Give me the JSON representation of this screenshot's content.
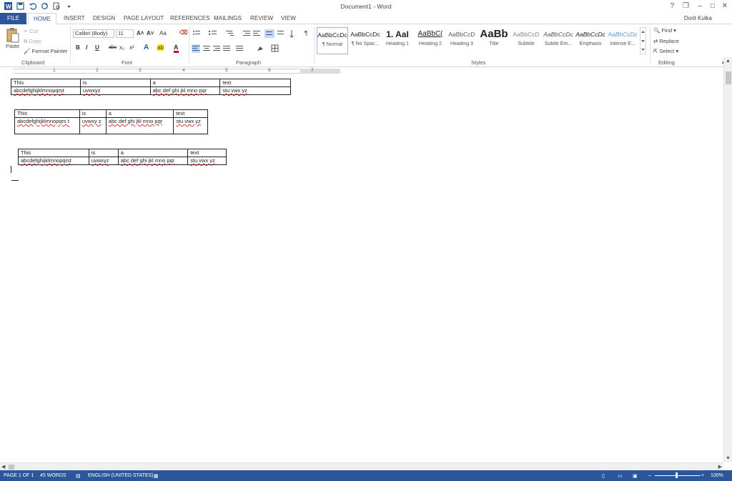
{
  "window": {
    "title": "Document1 - Word",
    "user_name": "Dorit Kulka",
    "help": "?",
    "controls": [
      "❐",
      "–",
      "□",
      "✕"
    ]
  },
  "quick_access": {
    "items": [
      "word-icon",
      "save-icon",
      "undo-icon",
      "redo-icon",
      "print-preview-icon",
      "customize-icon"
    ]
  },
  "tabs": {
    "file": "FILE",
    "home": "HOME",
    "insert": "INSERT",
    "design": "DESIGN",
    "page_layout": "PAGE LAYOUT",
    "references": "REFERENCES",
    "mailings": "MAILINGS",
    "review": "REVIEW",
    "view": "VIEW"
  },
  "clipboard": {
    "paste": "Paste",
    "cut": "Cut",
    "copy": "Copy",
    "format_painter": "Format Painter",
    "label": "Clipboard"
  },
  "font": {
    "name": "Calibri (Body)",
    "size": "11",
    "bold": "B",
    "italic": "I",
    "underline": "U",
    "strikethrough": "abc",
    "subscript": "x₂",
    "superscript": "x²",
    "grow": "A˄",
    "shrink": "A˅",
    "change_case": "Aa",
    "text_effects": "A",
    "highlight": "ab",
    "font_color": "A",
    "label": "Font"
  },
  "paragraph": {
    "label": "Paragraph",
    "pilcrow": "¶"
  },
  "styles": {
    "label": "Styles",
    "items": [
      {
        "preview": "AaBbCcDc",
        "name": "¶ Normal"
      },
      {
        "preview": "AaBbCcDc",
        "name": "¶ No Spac..."
      },
      {
        "preview": "1. AaI",
        "name": "Heading 1"
      },
      {
        "preview": "AaBbC(",
        "name": "Heading 2"
      },
      {
        "preview": "AaBbCcD",
        "name": "Heading 3"
      },
      {
        "preview": "AaBb",
        "name": "Title"
      },
      {
        "preview": "AaBbCcD",
        "name": "Subtitle"
      },
      {
        "preview": "AaBbCcDc",
        "name": "Subtle Em..."
      },
      {
        "preview": "AaBbCcDc",
        "name": "Emphasis"
      },
      {
        "preview": "AaBbCcDc",
        "name": "Intense E..."
      }
    ]
  },
  "editing": {
    "find": "Find",
    "replace": "Replace",
    "select": "Select",
    "label": "Editing"
  },
  "ruler": {
    "numbers": [
      "1",
      "2",
      "3",
      "4",
      "5",
      "6",
      "7"
    ]
  },
  "document": {
    "tables": [
      {
        "header": [
          "This",
          "is",
          "a",
          "text"
        ],
        "row": [
          "abcdefghijklmnopqrst",
          "uvwxyz",
          "abc def ghi jkl mno pqr",
          "stu vwx yz"
        ]
      },
      {
        "header": [
          "This",
          "is",
          "a",
          "text"
        ],
        "row": [
          "abcdefghijklmnopqrs t",
          "uvwxy z",
          "abc def ghi jkl mno pqr",
          "stu vwx yz"
        ]
      },
      {
        "header": [
          "This",
          "is",
          "a",
          "text"
        ],
        "row": [
          "abcdefghijklmnopqrst",
          "uvwxyz",
          "abc def ghi jkl mno pqr",
          "stu vwx yz"
        ]
      }
    ]
  },
  "status": {
    "page": "PAGE 1 OF 1",
    "words": "45 WORDS",
    "language": "ENGLISH (UNITED STATES)",
    "zoom": "100%",
    "minus": "–",
    "plus": "+"
  },
  "colors": {
    "brand": "#2b579a",
    "squiggle": "#d33333"
  }
}
